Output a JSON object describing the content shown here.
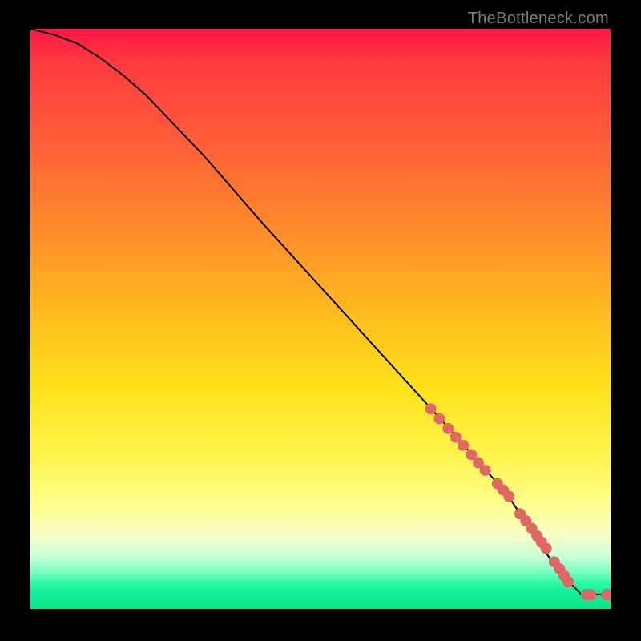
{
  "attribution": "TheBottleneck.com",
  "chart_data": {
    "type": "line",
    "title": "",
    "xlabel": "",
    "ylabel": "",
    "xlim": [
      0,
      100
    ],
    "ylim": [
      0,
      100
    ],
    "curve": {
      "name": "bottleneck-curve",
      "x": [
        0,
        4,
        8,
        12,
        16,
        20,
        30,
        40,
        50,
        60,
        70,
        78,
        82,
        86,
        88,
        90,
        92,
        95,
        100
      ],
      "y": [
        100,
        99,
        97.5,
        95,
        92,
        88.5,
        78,
        66.5,
        55.5,
        44.5,
        33.5,
        24.5,
        20,
        14,
        11,
        8,
        5.5,
        2.5,
        2.5
      ]
    },
    "scatter": {
      "name": "data-points",
      "color": "#e06765",
      "x": [
        69,
        70.5,
        72,
        73.3,
        74.6,
        76,
        77.2,
        78.4,
        80.5,
        81.5,
        82.5,
        84.4,
        85.4,
        86.4,
        87.3,
        88.1,
        88.9,
        90.3,
        91.2,
        92,
        92.7,
        95.8,
        96.6,
        99.3,
        100
      ],
      "y": [
        34.5,
        32.8,
        31.1,
        29.6,
        28.2,
        26.6,
        25.2,
        23.9,
        21.6,
        20.5,
        19.4,
        16.4,
        15.2,
        13.9,
        12.6,
        11.5,
        10.4,
        8.1,
        6.9,
        5.7,
        4.7,
        2.5,
        2.5,
        2.5,
        2.5
      ]
    }
  }
}
